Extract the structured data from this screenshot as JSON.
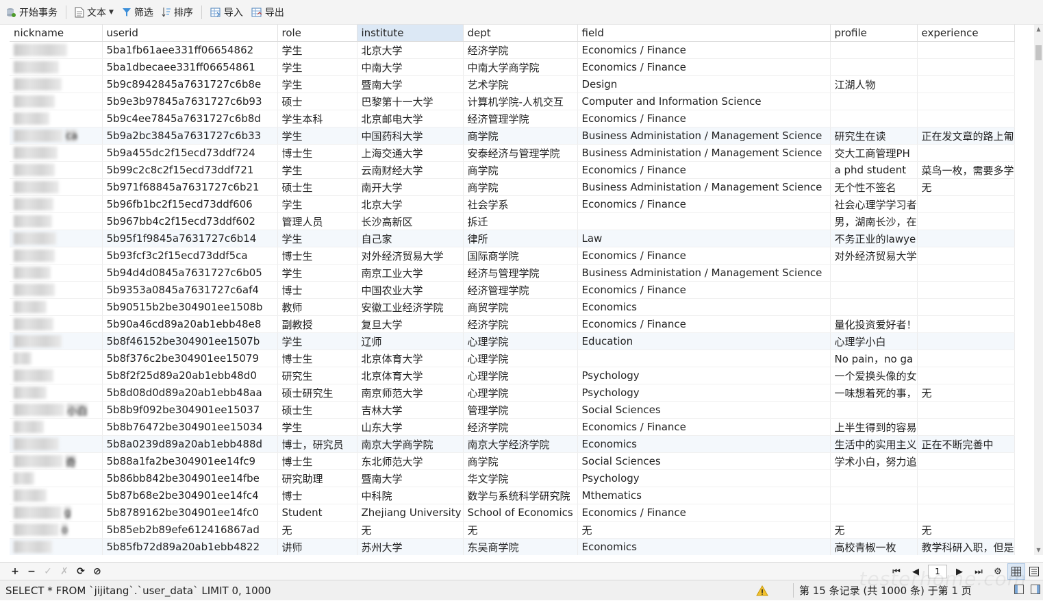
{
  "toolbar": {
    "begin_transaction": "开始事务",
    "text": "文本",
    "filter": "筛选",
    "sort": "排序",
    "import": "导入",
    "export": "导出"
  },
  "columns": [
    "nickname",
    "userid",
    "role",
    "institute",
    "dept",
    "field",
    "profile",
    "experience"
  ],
  "selected_column": "institute",
  "rows": [
    {
      "nick_suffix": "",
      "userid": "5ba1fb61aee331ff06654862",
      "role": "学生",
      "institute": "北京大学",
      "dept": "经济学院",
      "field": "Economics / Finance",
      "profile": "",
      "experience": ""
    },
    {
      "nick_suffix": "",
      "userid": "5ba1dbecaee331ff06654861",
      "role": "学生",
      "institute": "中南大学",
      "dept": "中南大学商学院",
      "field": "Economics / Finance",
      "profile": "",
      "experience": ""
    },
    {
      "nick_suffix": "",
      "userid": "5b9c8942845a7631727c6b8e",
      "role": "学生",
      "institute": "暨南大学",
      "dept": "艺术学院",
      "field": "Design",
      "profile": "江湖人物",
      "experience": ""
    },
    {
      "nick_suffix": "",
      "userid": "5b9e3b97845a7631727c6b93",
      "role": "硕士",
      "institute": "巴黎第十一大学",
      "dept": "计算机学院-人机交互",
      "field": "Computer and Information Science",
      "profile": "",
      "experience": ""
    },
    {
      "nick_suffix": "",
      "userid": "5b9c4ee7845a7631727c6b8d",
      "role": "学生本科",
      "institute": "北京邮电大学",
      "dept": "经济管理学院",
      "field": "Economics / Finance",
      "profile": "",
      "experience": ""
    },
    {
      "nick_suffix": "ca",
      "userid": "5b9a2bc3845a7631727c6b33",
      "role": "学生",
      "institute": "中国药科大学",
      "dept": "商学院",
      "field": "Business Administation / Management Science",
      "profile": "研究生在读",
      "experience": "正在发文章的路上匍"
    },
    {
      "nick_suffix": "",
      "userid": "5b9a455dc2f15ecd73ddf724",
      "role": "博士生",
      "institute": "上海交通大学",
      "dept": "安泰经济与管理学院",
      "field": "Business Administation / Management Science",
      "profile": "交大工商管理PH",
      "experience": ""
    },
    {
      "nick_suffix": "",
      "userid": "5b99c2c8c2f15ecd73ddf721",
      "role": "学生",
      "institute": "云南财经大学",
      "dept": "商学院",
      "field": "Economics / Finance",
      "profile": "a phd student",
      "experience": "菜鸟一枚，需要多学"
    },
    {
      "nick_suffix": "",
      "userid": "5b971f68845a7631727c6b21",
      "role": "硕士生",
      "institute": "南开大学",
      "dept": "商学院",
      "field": "Business Administation / Management Science",
      "profile": "无个性不签名",
      "experience": "无"
    },
    {
      "nick_suffix": "",
      "userid": "5b96fb1bc2f15ecd73ddf606",
      "role": "学生",
      "institute": "北京大学",
      "dept": "社会学系",
      "field": "Economics / Finance",
      "profile": "社会心理学学习者",
      "experience": ""
    },
    {
      "nick_suffix": "",
      "userid": "5b967bb4c2f15ecd73ddf602",
      "role": "管理人员",
      "institute": "长沙高新区",
      "dept": "拆迁",
      "field": "",
      "profile": "男，湖南长沙，在",
      "experience": ""
    },
    {
      "nick_suffix": "",
      "userid": "5b95f1f9845a7631727c6b14",
      "role": "学生",
      "institute": "自己家",
      "dept": "律所",
      "field": "Law",
      "profile": "不务正业的lawye",
      "experience": ""
    },
    {
      "nick_suffix": "",
      "userid": "5b93fcf3c2f15ecd73ddf5ca",
      "role": "博士生",
      "institute": "对外经济贸易大学",
      "dept": "国际商学院",
      "field": "Economics / Finance",
      "profile": "对外经济贸易大学",
      "experience": ""
    },
    {
      "nick_suffix": "",
      "userid": "5b94d4d0845a7631727c6b05",
      "role": "学生",
      "institute": "南京工业大学",
      "dept": "经济与管理学院",
      "field": "Business Administation / Management Science",
      "profile": "",
      "experience": ""
    },
    {
      "nick_suffix": "",
      "userid": "5b9353a0845a7631727c6af4",
      "role": "博士",
      "institute": "中国农业大学",
      "dept": "经济管理学院",
      "field": "Economics / Finance",
      "profile": "",
      "experience": ""
    },
    {
      "nick_suffix": "",
      "userid": "5b90515b2be304901ee1508b",
      "role": "教师",
      "institute": "安徽工业经济学院",
      "dept": "商贸学院",
      "field": "Economics",
      "profile": "",
      "experience": ""
    },
    {
      "nick_suffix": "",
      "userid": "5b90a46cd89a20ab1ebb48e8",
      "role": "副教授",
      "institute": "复旦大学",
      "dept": "经济学院",
      "field": "Economics / Finance",
      "profile": "量化投资爱好者！",
      "experience": ""
    },
    {
      "nick_suffix": "",
      "userid": "5b8f46152be304901ee1507b",
      "role": "学生",
      "institute": "辽师",
      "dept": "心理学院",
      "field": "Education",
      "profile": "心理学小白",
      "experience": ""
    },
    {
      "nick_suffix": "",
      "userid": "5b8f376c2be304901ee15079",
      "role": "博士生",
      "institute": "北京体育大学",
      "dept": "心理学院",
      "field": "",
      "profile": "No pain，no ga",
      "experience": ""
    },
    {
      "nick_suffix": "",
      "userid": "5b8f2f25d89a20ab1ebb48d0",
      "role": "研究生",
      "institute": "北京体育大学",
      "dept": "心理学院",
      "field": "Psychology",
      "profile": "一个爱换头像的女",
      "experience": ""
    },
    {
      "nick_suffix": "",
      "userid": "5b8d08d0d89a20ab1ebb48aa",
      "role": "硕士研究生",
      "institute": "南京师范大学",
      "dept": "心理学院",
      "field": "Psychology",
      "profile": "一味想着死的事，",
      "experience": "无"
    },
    {
      "nick_suffix": "小白",
      "userid": "5b8b9f092be304901ee15037",
      "role": "硕士生",
      "institute": "吉林大学",
      "dept": "管理学院",
      "field": "Social Sciences",
      "profile": "",
      "experience": ""
    },
    {
      "nick_suffix": "",
      "userid": "5b8b76472be304901ee15034",
      "role": "学生",
      "institute": "山东大学",
      "dept": "经济学院",
      "field": "Economics / Finance",
      "profile": "上半生得到的容易",
      "experience": ""
    },
    {
      "nick_suffix": "",
      "userid": "5b8a0239d89a20ab1ebb488d",
      "role": "博士，研究员",
      "institute": "南京大学商学院",
      "dept": "南京大学经济学院",
      "field": "Economics",
      "profile": "生活中的实用主义",
      "experience": "正在不断完善中"
    },
    {
      "nick_suffix": "奇",
      "userid": "5b88a1fa2be304901ee14fc9",
      "role": "博士生",
      "institute": "东北师范大学",
      "dept": "商学院",
      "field": "Social Sciences",
      "profile": "学术小白，努力追",
      "experience": ""
    },
    {
      "nick_suffix": "",
      "userid": "5b86bb842be304901ee14fbe",
      "role": "研究助理",
      "institute": "暨南大学",
      "dept": "华文学院",
      "field": "Psychology",
      "profile": "",
      "experience": ""
    },
    {
      "nick_suffix": "",
      "userid": "5b87b68e2be304901ee14fc4",
      "role": "博士",
      "institute": "中科院",
      "dept": "数学与系统科学研究院",
      "field": "Mthematics",
      "profile": "",
      "experience": ""
    },
    {
      "nick_suffix": "g",
      "userid": "5b8789162be304901ee14fc0",
      "role": "Student",
      "institute": "Zhejiang University",
      "dept": "School of Economics",
      "field": "Economics / Finance",
      "profile": "",
      "experience": ""
    },
    {
      "nick_suffix": "o",
      "userid": "5b85eb2b89efe612416867ad",
      "role": "无",
      "institute": "无",
      "dept": "无",
      "field": "无",
      "profile": "无",
      "experience": "无"
    },
    {
      "nick_suffix": "",
      "userid": "5b85fb72d89a20ab1ebb4822",
      "role": "讲师",
      "institute": "苏州大学",
      "dept": "东吴商学院",
      "field": "Economics",
      "profile": "高校青椒一枚",
      "experience": "教学科研入职，但是"
    }
  ],
  "navigation": {
    "add": "+",
    "remove": "−",
    "apply": "✓",
    "cancel": "✗",
    "refresh": "⟳",
    "stop": "⊘",
    "page": "1"
  },
  "status": {
    "sql": "SELECT * FROM `jijitang`.`user_data` LIMIT 0, 1000",
    "info": "第 15 条记录 (共 1000 条) 于第 1 页"
  },
  "watermark": "testerhome.com",
  "colors": {
    "selected_header": "#dce8f5",
    "alt_row": "#f4f8fc"
  }
}
